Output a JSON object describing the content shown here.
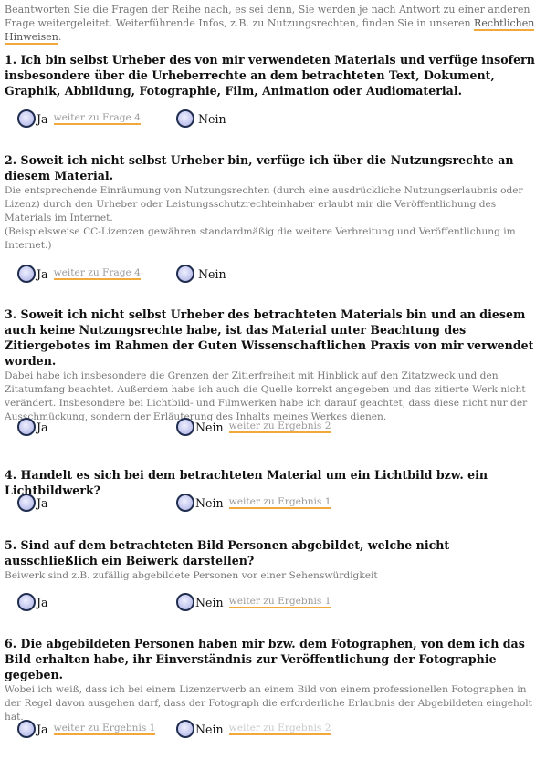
{
  "intro": {
    "text": "Beantworten Sie die Fragen der Reihe nach, es sei denn, Sie werden je nach Antwort zu einer anderen Frage weitergeleitet. Weiterführende Infos, z.B. zu Nutzungsrechten, finden Sie in unseren ",
    "link": "Rechtlichen Hinweisen",
    "end": "."
  },
  "questions": [
    {
      "title": "1. Ich bin selbst Urheber des von mir verwendeten Materials und verfüge insofern insbesondere über die Urheberrechte an dem betrachteten Text, Dokument, Graphik, Abbildung, Fotographie, Film, Animation oder Audiomaterial.",
      "desc": "",
      "yes": {
        "label": "Ja",
        "link": "weiter zu Frage 4"
      },
      "no": {
        "label": "Nein",
        "link": ""
      }
    },
    {
      "title": "2. Soweit ich nicht selbst Urheber bin, verfüge ich über die Nutzungsrechte an diesem Material.",
      "desc": "Die entsprechende Einräumung von Nutzungsrechten (durch eine ausdrückliche Nutzungserlaubnis oder Lizenz) durch den Urheber oder Leistungsschutzrechteinhaber erlaubt mir die Veröffentlichung des Materials im Internet.",
      "desc2": "(Beispielsweise CC-Lizenzen gewähren standardmäßig die weitere Verbreitung und Veröffentlichung im Internet.)",
      "yes": {
        "label": "Ja",
        "link": "weiter zu Frage 4"
      },
      "no": {
        "label": "Nein",
        "link": ""
      }
    },
    {
      "title": "3. Soweit ich nicht selbst Urheber des betrachteten Materials bin und an diesem auch keine Nutzungsrechte habe, ist das Material unter Beachtung des Zitiergebotes im Rahmen der Guten Wissenschaftlichen Praxis von mir verwendet worden.",
      "desc": "Dabei habe ich insbesondere die Grenzen der Zitierfreiheit mit Hinblick auf den Zitatzweck und den Zitatumfang beachtet. Außerdem habe ich auch die Quelle korrekt angegeben und das zitierte Werk nicht verändert. Insbesondere bei Lichtbild- und Filmwerken habe ich darauf geachtet, dass diese nicht nur der Ausschmückung, sondern der Erläuterung des Inhalts meines Werkes dienen.",
      "yes": {
        "label": "Ja",
        "link": ""
      },
      "no": {
        "label": "Nein",
        "link": "weiter zu Ergebnis 2"
      }
    },
    {
      "title": "4. Handelt es sich bei dem betrachteten Material um ein Lichtbild bzw. ein Lichtbildwerk?",
      "desc": "",
      "yes": {
        "label": "Ja",
        "link": ""
      },
      "no": {
        "label": "Nein",
        "link": "weiter zu Ergebnis 1"
      }
    },
    {
      "title": "5. Sind auf dem betrachteten Bild Personen abgebildet, welche nicht ausschließlich ein Beiwerk darstellen?",
      "desc": "Beiwerk sind z.B. zufällig abgebildete Personen vor einer Sehenswürdigkeit",
      "yes": {
        "label": "Ja",
        "link": ""
      },
      "no": {
        "label": "Nein",
        "link": "weiter zu Ergebnis 1"
      }
    },
    {
      "title": "6. Die abgebildeten Personen haben mir bzw. dem Fotographen, von dem ich das Bild erhalten habe, ihr Einverständnis zur Veröffentlichung der Fotographie gegeben.",
      "desc": "Wobei ich weiß, dass ich bei einem Lizenzerwerb an einem Bild von einem professionellen Fotographen in der Regel davon ausgehen darf, dass der Fotograph die erforderliche Erlaubnis der Abgebildeten eingeholt hat.",
      "yes": {
        "label": "Ja",
        "link": "weiter zu Ergebnis 1"
      },
      "no": {
        "label": "Nein",
        "link": "weiter zu Ergebnis 2"
      }
    }
  ]
}
